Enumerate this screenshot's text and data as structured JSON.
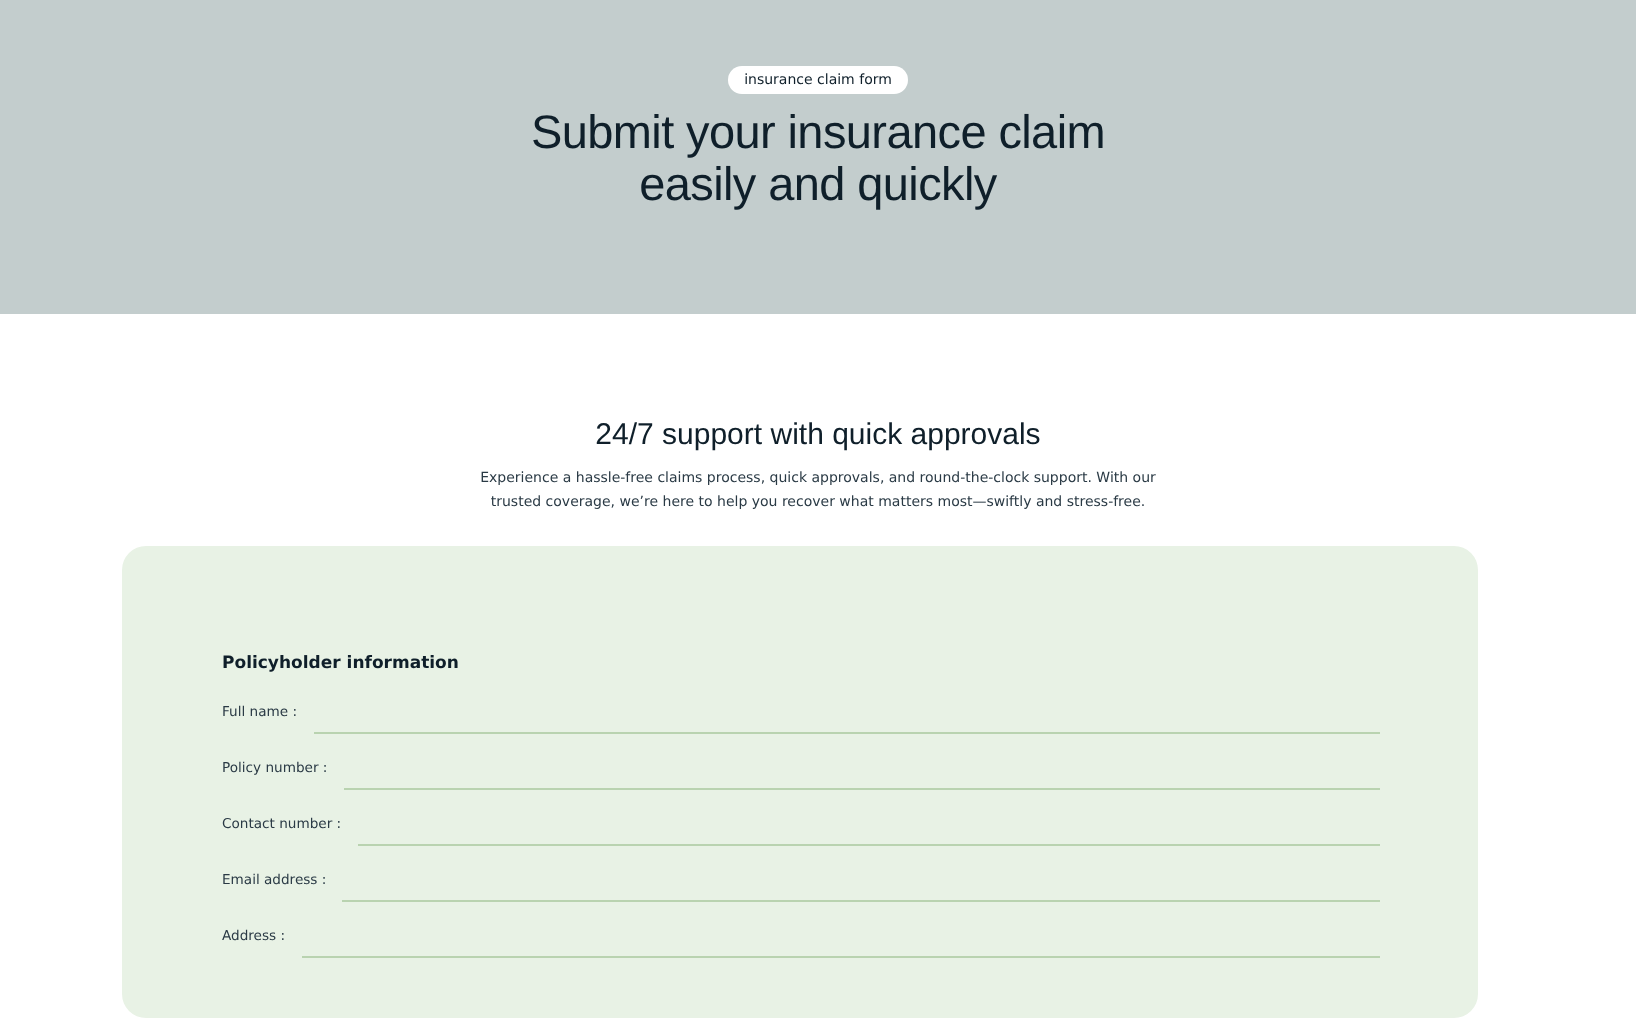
{
  "hero": {
    "badge": "insurance claim form",
    "title_lines": [
      "Submit your insurance claim",
      "easily and quickly"
    ]
  },
  "intro": {
    "heading": "24/7 support with quick approvals",
    "text": "Experience a hassle-free claims process, quick approvals, and round-the-clock support. With our trusted coverage, we’re here to help you recover what matters most—swiftly and stress-free."
  },
  "form": {
    "section_title": "Policyholder information",
    "fields": [
      {
        "label": "Full name :"
      },
      {
        "label": "Policy number :"
      },
      {
        "label": "Contact number :"
      },
      {
        "label": "Email address :"
      },
      {
        "label": "Address :"
      }
    ]
  }
}
